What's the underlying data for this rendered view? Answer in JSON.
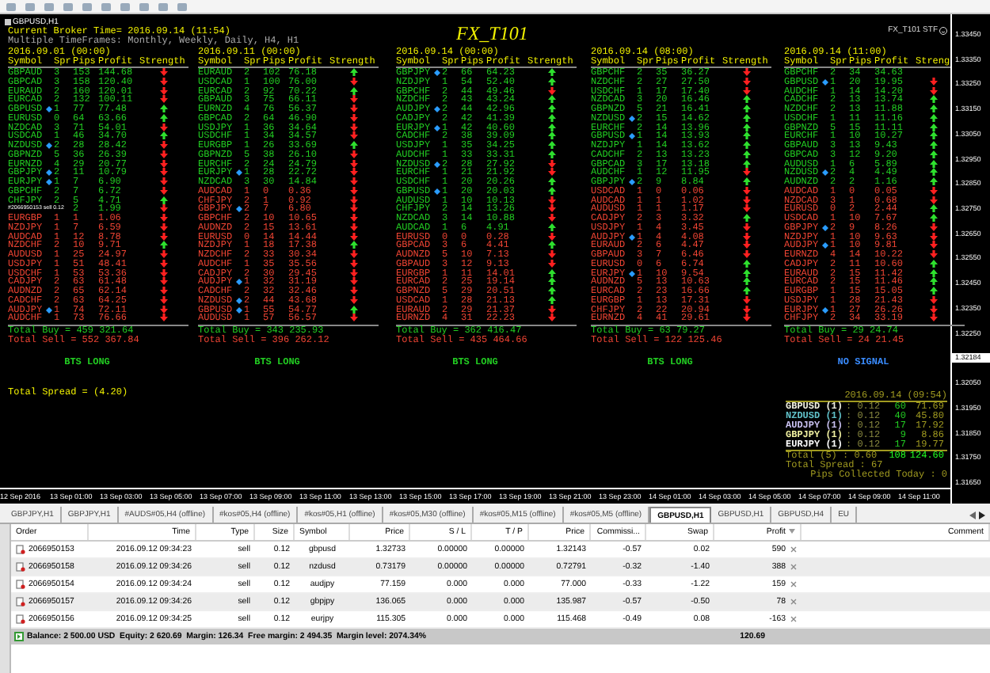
{
  "chart": {
    "title": "GBPUSD,H1",
    "broker_time": "Current Broker Time= 2016.09.14 (11:54)",
    "timeframes": "Multiple TimeFrames: Monthly, Weekly, Daily, H4, H1",
    "indicator_title": "FX_T101",
    "indicator_label": "FX_T101 STF",
    "panels": [
      {
        "date": "2016.09.01 (00:00)",
        "columns": [
          "Symbol",
          "Spr",
          "Pips",
          "Profit",
          "Strength"
        ],
        "rows": [
          {
            "symbol": "GBPAUD",
            "marked": false,
            "spr": "3",
            "pips": "153",
            "profit": "144.68",
            "rising": false,
            "buy": true
          },
          {
            "symbol": "GBPCAD",
            "marked": false,
            "spr": "3",
            "pips": "158",
            "profit": "120.40",
            "rising": false,
            "buy": true
          },
          {
            "symbol": "EURAUD",
            "marked": false,
            "spr": "2",
            "pips": "160",
            "profit": "120.01",
            "rising": false,
            "buy": true
          },
          {
            "symbol": "EURCAD",
            "marked": false,
            "spr": "2",
            "pips": "132",
            "profit": "100.11",
            "rising": false,
            "buy": true
          },
          {
            "symbol": "GBPUSD",
            "marked": true,
            "spr": "1",
            "pips": "77",
            "profit": "77.48",
            "rising": true,
            "buy": true
          },
          {
            "symbol": "EURUSD",
            "marked": false,
            "spr": "0",
            "pips": "64",
            "profit": "63.66",
            "rising": true,
            "buy": true
          },
          {
            "symbol": "NZDCAD",
            "marked": false,
            "spr": "3",
            "pips": "71",
            "profit": "54.01",
            "rising": false,
            "buy": true
          },
          {
            "symbol": "USDCAD",
            "marked": false,
            "spr": "1",
            "pips": "46",
            "profit": "34.70",
            "rising": true,
            "buy": true
          },
          {
            "symbol": "NZDUSD",
            "marked": true,
            "spr": "2",
            "pips": "28",
            "profit": "28.42",
            "rising": false,
            "buy": true
          },
          {
            "symbol": "GBPNZD",
            "marked": false,
            "spr": "5",
            "pips": "36",
            "profit": "26.39",
            "rising": false,
            "buy": true
          },
          {
            "symbol": "EURNZD",
            "marked": false,
            "spr": "4",
            "pips": "29",
            "profit": "20.77",
            "rising": false,
            "buy": true
          },
          {
            "symbol": "GBPJPY",
            "marked": true,
            "spr": "2",
            "pips": "11",
            "profit": "10.79",
            "rising": false,
            "buy": true
          },
          {
            "symbol": "EURJPY",
            "marked": true,
            "spr": "1",
            "pips": "7",
            "profit": "6.90",
            "rising": false,
            "buy": true
          },
          {
            "symbol": "GBPCHF",
            "marked": false,
            "spr": "2",
            "pips": "7",
            "profit": "6.72",
            "rising": false,
            "buy": true
          },
          {
            "symbol": "CHFJPY",
            "marked": false,
            "spr": "2",
            "pips": "5",
            "profit": "4.71",
            "rising": true,
            "buy": true
          },
          {
            "order_label": "#2066950153 sell 0.12",
            "pips": "2",
            "profit": "1.99",
            "rising": false,
            "buy": true
          },
          {
            "symbol": "EURGBP",
            "marked": false,
            "spr": "1",
            "pips": "1",
            "profit": "1.06",
            "rising": false,
            "buy": false
          },
          {
            "symbol": "NZDJPY",
            "marked": false,
            "spr": "1",
            "pips": "7",
            "profit": "6.59",
            "rising": false,
            "buy": false
          },
          {
            "symbol": "AUDCAD",
            "marked": false,
            "spr": "1",
            "pips": "12",
            "profit": "8.78",
            "rising": false,
            "buy": false
          },
          {
            "symbol": "NZDCHF",
            "marked": false,
            "spr": "2",
            "pips": "10",
            "profit": "9.71",
            "rising": true,
            "buy": false
          },
          {
            "symbol": "AUDUSD",
            "marked": false,
            "spr": "1",
            "pips": "25",
            "profit": "24.97",
            "rising": false,
            "buy": false
          },
          {
            "symbol": "USDJPY",
            "marked": false,
            "spr": "1",
            "pips": "51",
            "profit": "48.41",
            "rising": false,
            "buy": false
          },
          {
            "symbol": "USDCHF",
            "marked": false,
            "spr": "1",
            "pips": "53",
            "profit": "53.36",
            "rising": false,
            "buy": false
          },
          {
            "symbol": "CADJPY",
            "marked": false,
            "spr": "2",
            "pips": "63",
            "profit": "61.48",
            "rising": false,
            "buy": false
          },
          {
            "symbol": "AUDNZD",
            "marked": false,
            "spr": "2",
            "pips": "65",
            "profit": "62.14",
            "rising": false,
            "buy": false
          },
          {
            "symbol": "CADCHF",
            "marked": false,
            "spr": "2",
            "pips": "63",
            "profit": "64.25",
            "rising": false,
            "buy": false
          },
          {
            "symbol": "AUDJPY",
            "marked": true,
            "spr": "1",
            "pips": "74",
            "profit": "72.11",
            "rising": false,
            "buy": false
          },
          {
            "symbol": "AUDCHF",
            "marked": false,
            "spr": "1",
            "pips": "73",
            "profit": "76.66",
            "rising": false,
            "buy": false
          }
        ],
        "total_buy": "Total Buy = 459 321.64",
        "total_sell": "Total Sell = 552 367.84",
        "signal": {
          "text": "BTS LONG",
          "kind": "long"
        }
      },
      {
        "date": "2016.09.11 (00:00)",
        "columns": [
          "Symbol",
          "Spr",
          "Pips",
          "Profit",
          "Strength"
        ],
        "rows": [
          {
            "symbol": "EURAUD",
            "marked": false,
            "spr": "2",
            "pips": "102",
            "profit": "76.18",
            "rising": true,
            "buy": true
          },
          {
            "symbol": "USDCAD",
            "marked": false,
            "spr": "1",
            "pips": "100",
            "profit": "76.00",
            "rising": false,
            "buy": true
          },
          {
            "symbol": "EURCAD",
            "marked": false,
            "spr": "2",
            "pips": "92",
            "profit": "70.22",
            "rising": true,
            "buy": true
          },
          {
            "symbol": "GBPAUD",
            "marked": false,
            "spr": "3",
            "pips": "75",
            "profit": "66.11",
            "rising": false,
            "buy": true
          },
          {
            "symbol": "EURNZD",
            "marked": false,
            "spr": "4",
            "pips": "76",
            "profit": "56.37",
            "rising": false,
            "buy": true
          },
          {
            "symbol": "GBPCAD",
            "marked": false,
            "spr": "2",
            "pips": "64",
            "profit": "46.90",
            "rising": false,
            "buy": true
          },
          {
            "symbol": "USDJPY",
            "marked": false,
            "spr": "1",
            "pips": "36",
            "profit": "34.64",
            "rising": false,
            "buy": true
          },
          {
            "symbol": "USDCHF",
            "marked": false,
            "spr": "1",
            "pips": "34",
            "profit": "34.57",
            "rising": false,
            "buy": true
          },
          {
            "symbol": "EURGBP",
            "marked": false,
            "spr": "1",
            "pips": "26",
            "profit": "33.69",
            "rising": true,
            "buy": true
          },
          {
            "symbol": "GBPNZD",
            "marked": false,
            "spr": "5",
            "pips": "38",
            "profit": "26.10",
            "rising": false,
            "buy": true
          },
          {
            "symbol": "EURCHF",
            "marked": false,
            "spr": "2",
            "pips": "24",
            "profit": "24.79",
            "rising": false,
            "buy": true
          },
          {
            "symbol": "EURJPY",
            "marked": true,
            "spr": "1",
            "pips": "28",
            "profit": "22.72",
            "rising": false,
            "buy": true
          },
          {
            "symbol": "NZDCAD",
            "marked": false,
            "spr": "3",
            "pips": "30",
            "profit": "14.84",
            "rising": false,
            "buy": true
          },
          {
            "symbol": "AUDCAD",
            "marked": false,
            "spr": "1",
            "pips": "0",
            "profit": "0.36",
            "rising": false,
            "buy": false
          },
          {
            "symbol": "CHFJPY",
            "marked": false,
            "spr": "2",
            "pips": "1",
            "profit": "0.92",
            "rising": false,
            "buy": false
          },
          {
            "symbol": "GBPJPY",
            "marked": true,
            "spr": "2",
            "pips": "7",
            "profit": "6.80",
            "rising": false,
            "buy": false
          },
          {
            "symbol": "GBPCHF",
            "marked": false,
            "spr": "2",
            "pips": "10",
            "profit": "10.65",
            "rising": false,
            "buy": false
          },
          {
            "symbol": "AUDNZD",
            "marked": false,
            "spr": "2",
            "pips": "15",
            "profit": "13.61",
            "rising": false,
            "buy": false
          },
          {
            "symbol": "EURUSD",
            "marked": false,
            "spr": "0",
            "pips": "14",
            "profit": "14.44",
            "rising": false,
            "buy": false
          },
          {
            "symbol": "NZDJPY",
            "marked": false,
            "spr": "1",
            "pips": "18",
            "profit": "17.38",
            "rising": true,
            "buy": false
          },
          {
            "symbol": "NZDCHF",
            "marked": false,
            "spr": "2",
            "pips": "33",
            "profit": "30.34",
            "rising": false,
            "buy": false
          },
          {
            "symbol": "AUDCHF",
            "marked": false,
            "spr": "1",
            "pips": "35",
            "profit": "35.56",
            "rising": false,
            "buy": false
          },
          {
            "symbol": "CADJPY",
            "marked": false,
            "spr": "2",
            "pips": "30",
            "profit": "29.45",
            "rising": false,
            "buy": false
          },
          {
            "symbol": "AUDJPY",
            "marked": true,
            "spr": "1",
            "pips": "32",
            "profit": "31.19",
            "rising": false,
            "buy": false
          },
          {
            "symbol": "CADCHF",
            "marked": false,
            "spr": "2",
            "pips": "32",
            "profit": "32.46",
            "rising": false,
            "buy": false
          },
          {
            "symbol": "NZDUSD",
            "marked": true,
            "spr": "2",
            "pips": "44",
            "profit": "43.68",
            "rising": false,
            "buy": false
          },
          {
            "symbol": "GBPUSD",
            "marked": true,
            "spr": "1",
            "pips": "55",
            "profit": "54.77",
            "rising": true,
            "buy": false
          },
          {
            "symbol": "AUDUSD",
            "marked": false,
            "spr": "1",
            "pips": "57",
            "profit": "56.57",
            "rising": false,
            "buy": false
          }
        ],
        "total_buy": "Total Buy = 343 235.93",
        "total_sell": "Total Sell = 396 262.12",
        "signal": {
          "text": "BTS LONG",
          "kind": "long"
        }
      },
      {
        "date": "2016.09.14 (00:00)",
        "columns": [
          "Symbol",
          "Spr",
          "Pips",
          "Profit",
          "Strength"
        ],
        "rows": [
          {
            "symbol": "GBPJPY",
            "marked": true,
            "spr": "2",
            "pips": "66",
            "profit": "64.23",
            "rising": true,
            "buy": true
          },
          {
            "symbol": "NZDJPY",
            "marked": false,
            "spr": "1",
            "pips": "54",
            "profit": "52.40",
            "rising": true,
            "buy": true
          },
          {
            "symbol": "GBPCHF",
            "marked": false,
            "spr": "2",
            "pips": "44",
            "profit": "49.46",
            "rising": false,
            "buy": true
          },
          {
            "symbol": "NZDCHF",
            "marked": false,
            "spr": "2",
            "pips": "43",
            "profit": "43.24",
            "rising": true,
            "buy": true
          },
          {
            "symbol": "AUDJPY",
            "marked": true,
            "spr": "2",
            "pips": "44",
            "profit": "42.96",
            "rising": true,
            "buy": true
          },
          {
            "symbol": "CADJPY",
            "marked": false,
            "spr": "2",
            "pips": "42",
            "profit": "41.39",
            "rising": true,
            "buy": true
          },
          {
            "symbol": "EURJPY",
            "marked": true,
            "spr": "1",
            "pips": "42",
            "profit": "40.60",
            "rising": true,
            "buy": true
          },
          {
            "symbol": "CADCHF",
            "marked": false,
            "spr": "2",
            "pips": "38",
            "profit": "39.09",
            "rising": true,
            "buy": true
          },
          {
            "symbol": "USDJPY",
            "marked": false,
            "spr": "1",
            "pips": "35",
            "profit": "34.25",
            "rising": true,
            "buy": true
          },
          {
            "symbol": "AUDCHF",
            "marked": false,
            "spr": "1",
            "pips": "33",
            "profit": "33.31",
            "rising": true,
            "buy": true
          },
          {
            "symbol": "NZDUSD",
            "marked": true,
            "spr": "2",
            "pips": "28",
            "profit": "27.92",
            "rising": false,
            "buy": true
          },
          {
            "symbol": "EURCHF",
            "marked": false,
            "spr": "1",
            "pips": "21",
            "profit": "21.92",
            "rising": false,
            "buy": true
          },
          {
            "symbol": "USDCHF",
            "marked": false,
            "spr": "1",
            "pips": "20",
            "profit": "20.26",
            "rising": true,
            "buy": true
          },
          {
            "symbol": "GBPUSD",
            "marked": true,
            "spr": "1",
            "pips": "20",
            "profit": "20.03",
            "rising": true,
            "buy": true
          },
          {
            "symbol": "AUDUSD",
            "marked": false,
            "spr": "1",
            "pips": "10",
            "profit": "10.13",
            "rising": false,
            "buy": true
          },
          {
            "symbol": "CHFJPY",
            "marked": false,
            "spr": "2",
            "pips": "14",
            "profit": "13.26",
            "rising": false,
            "buy": true
          },
          {
            "symbol": "NZDCAD",
            "marked": false,
            "spr": "3",
            "pips": "14",
            "profit": "10.88",
            "rising": false,
            "buy": true
          },
          {
            "symbol": "AUDCAD",
            "marked": false,
            "spr": "1",
            "pips": "6",
            "profit": "4.91",
            "rising": true,
            "buy": true
          },
          {
            "symbol": "EURUSD",
            "marked": false,
            "spr": "0",
            "pips": "0",
            "profit": "0.28",
            "rising": false,
            "buy": false
          },
          {
            "symbol": "GBPCAD",
            "marked": false,
            "spr": "3",
            "pips": "6",
            "profit": "4.41",
            "rising": true,
            "buy": false
          },
          {
            "symbol": "AUDNZD",
            "marked": false,
            "spr": "5",
            "pips": "10",
            "profit": "7.13",
            "rising": false,
            "buy": false
          },
          {
            "symbol": "GBPAUD",
            "marked": false,
            "spr": "3",
            "pips": "12",
            "profit": "9.13",
            "rising": false,
            "buy": false
          },
          {
            "symbol": "EURGBP",
            "marked": false,
            "spr": "1",
            "pips": "11",
            "profit": "14.01",
            "rising": true,
            "buy": false
          },
          {
            "symbol": "EURCAD",
            "marked": false,
            "spr": "2",
            "pips": "25",
            "profit": "19.14",
            "rising": true,
            "buy": false
          },
          {
            "symbol": "GBPNZD",
            "marked": false,
            "spr": "5",
            "pips": "29",
            "profit": "20.51",
            "rising": true,
            "buy": false
          },
          {
            "symbol": "USDCAD",
            "marked": false,
            "spr": "1",
            "pips": "28",
            "profit": "21.13",
            "rising": true,
            "buy": false
          },
          {
            "symbol": "EURAUD",
            "marked": false,
            "spr": "2",
            "pips": "29",
            "profit": "21.37",
            "rising": false,
            "buy": false
          },
          {
            "symbol": "EURNZD",
            "marked": false,
            "spr": "4",
            "pips": "31",
            "profit": "22.23",
            "rising": false,
            "buy": false
          }
        ],
        "total_buy": "Total Buy = 362 416.47",
        "total_sell": "Total Sell = 435 464.66",
        "signal": {
          "text": "BTS LONG",
          "kind": "long"
        }
      },
      {
        "date": "2016.09.14 (08:00)",
        "columns": [
          "Symbol",
          "Spr",
          "Pips",
          "Profit",
          "Strength"
        ],
        "rows": [
          {
            "symbol": "GBPCHF",
            "marked": false,
            "spr": "2",
            "pips": "35",
            "profit": "36.27",
            "rising": false,
            "buy": true
          },
          {
            "symbol": "NZDCHF",
            "marked": false,
            "spr": "2",
            "pips": "27",
            "profit": "27.50",
            "rising": false,
            "buy": true
          },
          {
            "symbol": "USDCHF",
            "marked": false,
            "spr": "1",
            "pips": "17",
            "profit": "17.40",
            "rising": false,
            "buy": true
          },
          {
            "symbol": "NZDCAD",
            "marked": false,
            "spr": "3",
            "pips": "20",
            "profit": "16.46",
            "rising": true,
            "buy": true
          },
          {
            "symbol": "GBPNZD",
            "marked": false,
            "spr": "5",
            "pips": "21",
            "profit": "16.41",
            "rising": true,
            "buy": true
          },
          {
            "symbol": "NZDUSD",
            "marked": true,
            "spr": "2",
            "pips": "15",
            "profit": "14.62",
            "rising": true,
            "buy": true
          },
          {
            "symbol": "EURCHF",
            "marked": false,
            "spr": "2",
            "pips": "14",
            "profit": "13.96",
            "rising": true,
            "buy": true
          },
          {
            "symbol": "GBPUSD",
            "marked": true,
            "spr": "1",
            "pips": "14",
            "profit": "13.93",
            "rising": true,
            "buy": true
          },
          {
            "symbol": "NZDJPY",
            "marked": false,
            "spr": "1",
            "pips": "14",
            "profit": "13.62",
            "rising": true,
            "buy": true
          },
          {
            "symbol": "CADCHF",
            "marked": false,
            "spr": "2",
            "pips": "13",
            "profit": "13.23",
            "rising": true,
            "buy": true
          },
          {
            "symbol": "GBPCAD",
            "marked": false,
            "spr": "3",
            "pips": "17",
            "profit": "13.18",
            "rising": true,
            "buy": true
          },
          {
            "symbol": "AUDCHF",
            "marked": false,
            "spr": "1",
            "pips": "12",
            "profit": "11.95",
            "rising": false,
            "buy": true
          },
          {
            "symbol": "GBPJPY",
            "marked": true,
            "spr": "2",
            "pips": "9",
            "profit": "8.84",
            "rising": true,
            "buy": true
          },
          {
            "symbol": "USDCAD",
            "marked": false,
            "spr": "1",
            "pips": "0",
            "profit": "0.06",
            "rising": false,
            "buy": false
          },
          {
            "symbol": "AUDCAD",
            "marked": false,
            "spr": "1",
            "pips": "1",
            "profit": "1.02",
            "rising": false,
            "buy": false
          },
          {
            "symbol": "AUDUSD",
            "marked": false,
            "spr": "1",
            "pips": "1",
            "profit": "1.17",
            "rising": false,
            "buy": false
          },
          {
            "symbol": "CADJPY",
            "marked": false,
            "spr": "2",
            "pips": "3",
            "profit": "3.32",
            "rising": true,
            "buy": false
          },
          {
            "symbol": "USDJPY",
            "marked": false,
            "spr": "1",
            "pips": "4",
            "profit": "3.45",
            "rising": false,
            "buy": false
          },
          {
            "symbol": "AUDJPY",
            "marked": true,
            "spr": "1",
            "pips": "4",
            "profit": "4.08",
            "rising": false,
            "buy": false
          },
          {
            "symbol": "EURAUD",
            "marked": false,
            "spr": "2",
            "pips": "6",
            "profit": "4.47",
            "rising": false,
            "buy": false
          },
          {
            "symbol": "GBPAUD",
            "marked": false,
            "spr": "3",
            "pips": "7",
            "profit": "6.46",
            "rising": false,
            "buy": false
          },
          {
            "symbol": "EURUSD",
            "marked": false,
            "spr": "0",
            "pips": "6",
            "profit": "6.74",
            "rising": true,
            "buy": false
          },
          {
            "symbol": "EURJPY",
            "marked": true,
            "spr": "1",
            "pips": "10",
            "profit": "9.54",
            "rising": true,
            "buy": false
          },
          {
            "symbol": "AUDNZD",
            "marked": false,
            "spr": "5",
            "pips": "13",
            "profit": "10.63",
            "rising": true,
            "buy": false
          },
          {
            "symbol": "EURCAD",
            "marked": false,
            "spr": "2",
            "pips": "23",
            "profit": "16.66",
            "rising": true,
            "buy": false
          },
          {
            "symbol": "EURGBP",
            "marked": false,
            "spr": "1",
            "pips": "13",
            "profit": "17.31",
            "rising": false,
            "buy": false
          },
          {
            "symbol": "CHFJPY",
            "marked": false,
            "spr": "2",
            "pips": "22",
            "profit": "20.94",
            "rising": false,
            "buy": false
          },
          {
            "symbol": "EURNZD",
            "marked": false,
            "spr": "4",
            "pips": "41",
            "profit": "29.61",
            "rising": false,
            "buy": false
          }
        ],
        "total_buy": "Total Buy = 63 79.27",
        "total_sell": "Total Sell = 122 125.46",
        "signal": {
          "text": "BTS LONG",
          "kind": "long"
        }
      },
      {
        "date": "2016.09.14 (11:00)",
        "columns": [
          "Symbol",
          "Spr",
          "Pips",
          "Profit",
          "Streng"
        ],
        "rows": [
          {
            "symbol": "GBPCHF",
            "marked": false,
            "spr": "2",
            "pips": "34",
            "profit": "34.63",
            "buy": true
          },
          {
            "symbol": "GBPUSD",
            "marked": true,
            "spr": "1",
            "pips": "20",
            "profit": "19.95",
            "rising": false,
            "buy": true
          },
          {
            "symbol": "AUDCHF",
            "marked": false,
            "spr": "1",
            "pips": "14",
            "profit": "14.20",
            "rising": false,
            "buy": true
          },
          {
            "symbol": "CADCHF",
            "marked": false,
            "spr": "2",
            "pips": "13",
            "profit": "13.74",
            "rising": true,
            "buy": true
          },
          {
            "symbol": "NZDCHF",
            "marked": false,
            "spr": "2",
            "pips": "13",
            "profit": "11.88",
            "rising": true,
            "buy": true
          },
          {
            "symbol": "USDCHF",
            "marked": false,
            "spr": "1",
            "pips": "11",
            "profit": "11.16",
            "rising": true,
            "buy": true
          },
          {
            "symbol": "GBPNZD",
            "marked": false,
            "spr": "5",
            "pips": "15",
            "profit": "11.11",
            "rising": true,
            "buy": true
          },
          {
            "symbol": "EURCHF",
            "marked": false,
            "spr": "1",
            "pips": "10",
            "profit": "10.27",
            "rising": true,
            "buy": true
          },
          {
            "symbol": "GBPAUD",
            "marked": false,
            "spr": "3",
            "pips": "13",
            "profit": "9.43",
            "rising": true,
            "buy": true
          },
          {
            "symbol": "GBPCAD",
            "marked": false,
            "spr": "3",
            "pips": "12",
            "profit": "9.20",
            "rising": true,
            "buy": true
          },
          {
            "symbol": "AUDUSD",
            "marked": false,
            "spr": "1",
            "pips": "6",
            "profit": "5.89",
            "rising": true,
            "buy": true
          },
          {
            "symbol": "NZDUSD",
            "marked": true,
            "spr": "2",
            "pips": "4",
            "profit": "4.49",
            "rising": true,
            "buy": true
          },
          {
            "symbol": "AUDNZD",
            "marked": false,
            "spr": "2",
            "pips": "2",
            "profit": "1.16",
            "rising": true,
            "buy": true
          },
          {
            "symbol": "AUDCAD",
            "marked": false,
            "spr": "1",
            "pips": "0",
            "profit": "0.05",
            "rising": false,
            "buy": false
          },
          {
            "symbol": "NZDCAD",
            "marked": false,
            "spr": "3",
            "pips": "1",
            "profit": "0.68",
            "rising": false,
            "buy": false
          },
          {
            "symbol": "EURUSD",
            "marked": false,
            "spr": "0",
            "pips": "2",
            "profit": "2.44",
            "rising": true,
            "buy": false
          },
          {
            "symbol": "USDCAD",
            "marked": false,
            "spr": "1",
            "pips": "10",
            "profit": "7.67",
            "rising": true,
            "buy": false
          },
          {
            "symbol": "GBPJPY",
            "marked": true,
            "spr": "2",
            "pips": "9",
            "profit": "8.26",
            "rising": false,
            "buy": false
          },
          {
            "symbol": "NZDJPY",
            "marked": false,
            "spr": "1",
            "pips": "10",
            "profit": "9.63",
            "rising": false,
            "buy": false
          },
          {
            "symbol": "AUDJPY",
            "marked": true,
            "spr": "1",
            "pips": "10",
            "profit": "9.81",
            "rising": false,
            "buy": false
          },
          {
            "symbol": "EURNZD",
            "marked": false,
            "spr": "4",
            "pips": "14",
            "profit": "10.22",
            "rising": false,
            "buy": false
          },
          {
            "symbol": "CADJPY",
            "marked": false,
            "spr": "2",
            "pips": "11",
            "profit": "10.60",
            "rising": true,
            "buy": false
          },
          {
            "symbol": "EURAUD",
            "marked": false,
            "spr": "2",
            "pips": "15",
            "profit": "11.42",
            "rising": true,
            "buy": false
          },
          {
            "symbol": "EURCAD",
            "marked": false,
            "spr": "2",
            "pips": "15",
            "profit": "11.46",
            "rising": true,
            "buy": false
          },
          {
            "symbol": "EURGBP",
            "marked": false,
            "spr": "1",
            "pips": "15",
            "profit": "15.05",
            "rising": true,
            "buy": false
          },
          {
            "symbol": "USDJPY",
            "marked": false,
            "spr": "1",
            "pips": "28",
            "profit": "21.43",
            "rising": false,
            "buy": false
          },
          {
            "symbol": "EURJPY",
            "marked": true,
            "spr": "1",
            "pips": "27",
            "profit": "26.26",
            "rising": false,
            "buy": false
          },
          {
            "symbol": "CHFJPY",
            "marked": false,
            "spr": "2",
            "pips": "34",
            "profit": "33.19",
            "rising": false,
            "buy": false
          }
        ],
        "total_buy": "Total Buy = 29 24.74",
        "total_sell": "Total Sell = 24 21.45",
        "signal": {
          "text": "NO SIGNAL",
          "kind": "none"
        }
      }
    ],
    "total_spread": "Total Spread =  (4.20)",
    "summary": {
      "date": "2016.09.14 (09:54)",
      "rows": [
        {
          "symbol": "GBPUSD (1)",
          "lots": ": 0.12",
          "pips": "60",
          "profit": "71.69",
          "color": "#f0f0e0"
        },
        {
          "symbol": "NZDUSD (1)",
          "lots": ": 0.12",
          "pips": "40",
          "profit": "45.80",
          "color": "#60c0c8"
        },
        {
          "symbol": "AUDJPY (1)",
          "lots": ": 0.12",
          "pips": "17",
          "profit": "17.92",
          "color": "#c8c0f0"
        },
        {
          "symbol": "GBPJPY (1)",
          "lots": ": 0.12",
          "pips": "9",
          "profit": "8.86",
          "color": "#f0f0a0"
        },
        {
          "symbol": "EURJPY (1)",
          "lots": ": 0.12",
          "pips": "17",
          "profit": "19.77",
          "color": "#ffffff"
        }
      ],
      "total": "Total (5) : 0.60",
      "total_pips": "108",
      "total_profit": "124.60",
      "spread": "Total Spread : 67",
      "pips_today": "Pips Collected Today : 0"
    },
    "price_axis": [
      {
        "label": "1.33450",
        "current": false
      },
      {
        "label": "1.33350",
        "current": false
      },
      {
        "label": "1.33250",
        "current": false
      },
      {
        "label": "1.33150",
        "current": false
      },
      {
        "label": "1.33050",
        "current": false
      },
      {
        "label": "1.32950",
        "current": false
      },
      {
        "label": "1.32850",
        "current": false
      },
      {
        "label": "1.32750",
        "current": false
      },
      {
        "label": "1.32650",
        "current": false
      },
      {
        "label": "1.32550",
        "current": false
      },
      {
        "label": "1.32450",
        "current": false
      },
      {
        "label": "1.32350",
        "current": false
      },
      {
        "label": "1.32250",
        "current": false
      },
      {
        "label": "1.32184",
        "current": true
      },
      {
        "label": "1.32050",
        "current": false
      },
      {
        "label": "1.31950",
        "current": false
      },
      {
        "label": "1.31850",
        "current": false
      },
      {
        "label": "1.31750",
        "current": false
      },
      {
        "label": "1.31650",
        "current": false
      }
    ],
    "time_axis": [
      "12 Sep 2016",
      "13 Sep 01:00",
      "13 Sep 03:00",
      "13 Sep 05:00",
      "13 Sep 07:00",
      "13 Sep 09:00",
      "13 Sep 11:00",
      "13 Sep 13:00",
      "13 Sep 15:00",
      "13 Sep 17:00",
      "13 Sep 19:00",
      "13 Sep 21:00",
      "13 Sep 23:00",
      "14 Sep 01:00",
      "14 Sep 03:00",
      "14 Sep 05:00",
      "14 Sep 07:00",
      "14 Sep 09:00",
      "14 Sep 11:00"
    ]
  },
  "chart_tabs": [
    {
      "label": "GBPJPY,H1",
      "selected": false
    },
    {
      "label": "GBPJPY,H1",
      "selected": false
    },
    {
      "label": "#AUDS#05,H4 (offline)",
      "selected": false
    },
    {
      "label": "#kos#05,H4 (offline)",
      "selected": false
    },
    {
      "label": "#kos#05,H1 (offline)",
      "selected": false
    },
    {
      "label": "#kos#05,M30 (offline)",
      "selected": false
    },
    {
      "label": "#kos#05,M15 (offline)",
      "selected": false
    },
    {
      "label": "#kos#05,M5 (offline)",
      "selected": false
    },
    {
      "label": "GBPUSD,H1",
      "selected": true
    },
    {
      "label": "GBPUSD,H1",
      "selected": false
    },
    {
      "label": "GBPUSD,H4",
      "selected": false
    },
    {
      "label": "EU",
      "selected": false
    }
  ],
  "orders": {
    "columns": [
      "Order",
      "Time",
      "Type",
      "Size",
      "Symbol",
      "Price",
      "S / L",
      "T / P",
      "Price",
      "Commissi...",
      "Swap",
      "Profit",
      "Comment"
    ],
    "rows": [
      [
        "2066950153",
        "2016.09.12 09:34:23",
        "sell",
        "0.12",
        "gbpusd",
        "1.32733",
        "0.00000",
        "0.00000",
        "1.32143",
        "-0.57",
        "0.02",
        "590"
      ],
      [
        "2066950158",
        "2016.09.12 09:34:26",
        "sell",
        "0.12",
        "nzdusd",
        "0.73179",
        "0.00000",
        "0.00000",
        "0.72791",
        "-0.32",
        "-1.40",
        "388"
      ],
      [
        "2066950154",
        "2016.09.12 09:34:24",
        "sell",
        "0.12",
        "audjpy",
        "77.159",
        "0.000",
        "0.000",
        "77.000",
        "-0.33",
        "-1.22",
        "159"
      ],
      [
        "2066950157",
        "2016.09.12 09:34:26",
        "sell",
        "0.12",
        "gbpjpy",
        "136.065",
        "0.000",
        "0.000",
        "135.987",
        "-0.57",
        "-0.50",
        "78"
      ],
      [
        "2066950156",
        "2016.09.12 09:34:25",
        "sell",
        "0.12",
        "eurjpy",
        "115.305",
        "0.000",
        "0.000",
        "115.468",
        "-0.49",
        "0.08",
        "-163"
      ]
    ],
    "balance": "Balance: 2 500.00 USD  Equity: 2 620.69  Margin: 126.34  Free margin: 2 494.35  Margin level: 2074.34%",
    "total_profit": "120.69"
  }
}
